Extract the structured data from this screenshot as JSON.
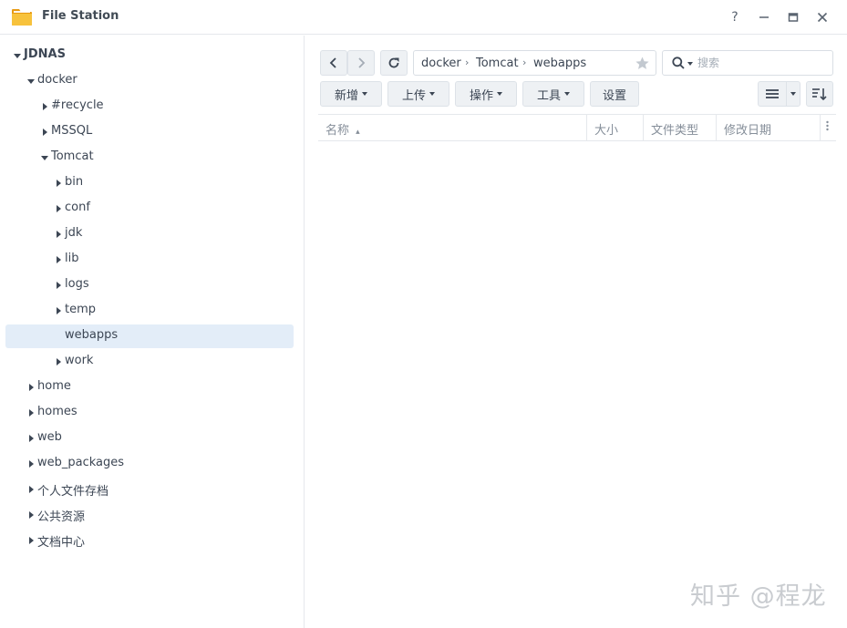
{
  "window": {
    "title": "File Station",
    "controls": {
      "help": "?",
      "minimize": "—",
      "maximize": "▭",
      "close": "✕"
    }
  },
  "sidebar": {
    "items": [
      {
        "label": "JDNAS",
        "depth": 0,
        "state": "expanded"
      },
      {
        "label": "docker",
        "depth": 1,
        "state": "expanded"
      },
      {
        "label": "#recycle",
        "depth": 2,
        "state": "collapsed"
      },
      {
        "label": "MSSQL",
        "depth": 2,
        "state": "collapsed"
      },
      {
        "label": "Tomcat",
        "depth": 2,
        "state": "expanded"
      },
      {
        "label": "bin",
        "depth": 3,
        "state": "collapsed"
      },
      {
        "label": "conf",
        "depth": 3,
        "state": "collapsed"
      },
      {
        "label": "jdk",
        "depth": 3,
        "state": "collapsed"
      },
      {
        "label": "lib",
        "depth": 3,
        "state": "collapsed"
      },
      {
        "label": "logs",
        "depth": 3,
        "state": "collapsed"
      },
      {
        "label": "temp",
        "depth": 3,
        "state": "collapsed"
      },
      {
        "label": "webapps",
        "depth": 3,
        "state": "leaf",
        "selected": true
      },
      {
        "label": "work",
        "depth": 3,
        "state": "collapsed"
      },
      {
        "label": "home",
        "depth": 1,
        "state": "collapsed"
      },
      {
        "label": "homes",
        "depth": 1,
        "state": "collapsed"
      },
      {
        "label": "web",
        "depth": 1,
        "state": "collapsed"
      },
      {
        "label": "web_packages",
        "depth": 1,
        "state": "collapsed"
      },
      {
        "label": "个人文件存档",
        "depth": 1,
        "state": "collapsed"
      },
      {
        "label": "公共资源",
        "depth": 1,
        "state": "collapsed"
      },
      {
        "label": "文档中心",
        "depth": 1,
        "state": "collapsed"
      }
    ]
  },
  "toolbar": {
    "breadcrumb": [
      "docker",
      "Tomcat",
      "webapps"
    ],
    "breadcrumb_separator": "›",
    "search_placeholder": "搜索",
    "actions": {
      "create": "新增",
      "upload": "上传",
      "action": "操作",
      "tools": "工具",
      "settings": "设置"
    }
  },
  "file_list": {
    "columns": {
      "name": "名称",
      "size": "大小",
      "type": "文件类型",
      "modified": "修改日期"
    },
    "sort_indicator": "▴",
    "rows": []
  },
  "watermark": "知乎 @程龙",
  "colors": {
    "selected_row": "#e3edf8",
    "button_bg": "#eef1f4",
    "folder_icon": "#f5b324",
    "text": "#3c4654",
    "muted_text": "#858e99"
  }
}
